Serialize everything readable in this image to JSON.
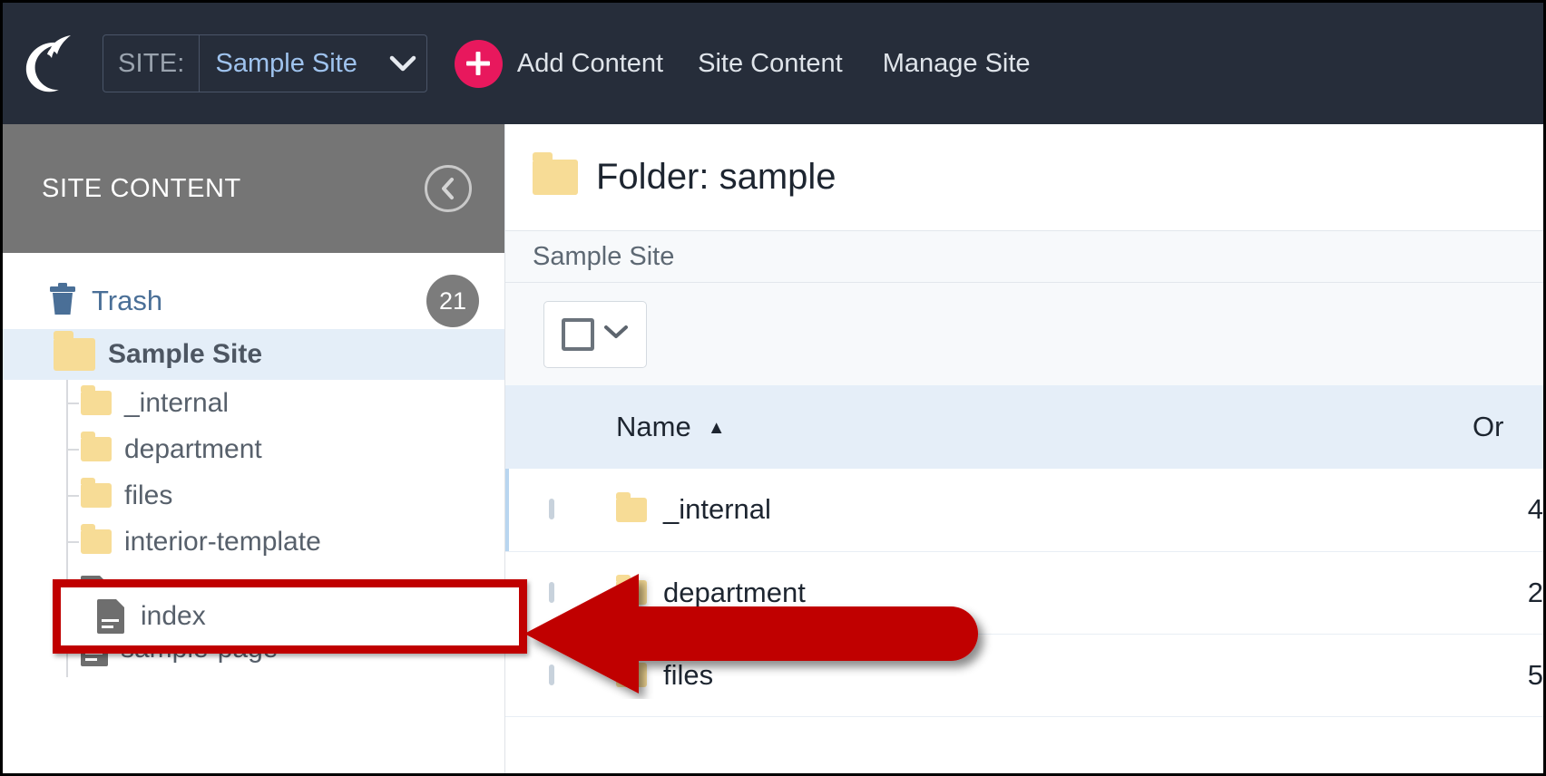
{
  "header": {
    "logo_name": "cascade-cms-logo",
    "site_selector": {
      "label": "SITE:",
      "value": "Sample Site"
    },
    "add_content_label": "Add Content",
    "nav_links": [
      {
        "label": "Site Content"
      },
      {
        "label": "Manage Site"
      }
    ],
    "accent_pink": "#e8185d",
    "background": "#262d3a"
  },
  "sidebar": {
    "title": "SITE CONTENT",
    "collapse_icon": "chevron-left-icon",
    "trash": {
      "label": "Trash",
      "count": "21"
    },
    "tree": [
      {
        "label": "Sample Site",
        "type": "folder",
        "level": 0,
        "selected": true
      },
      {
        "label": "_internal",
        "type": "folder",
        "level": 1,
        "selected": false
      },
      {
        "label": "department",
        "type": "folder",
        "level": 1,
        "selected": false
      },
      {
        "label": "files",
        "type": "folder",
        "level": 1,
        "selected": false
      },
      {
        "label": "interior-template",
        "type": "folder",
        "level": 1,
        "selected": false
      },
      {
        "label": "index",
        "type": "page",
        "level": 1,
        "selected": false,
        "highlighted": true
      },
      {
        "label": "sample-page",
        "type": "page",
        "level": 1,
        "selected": false
      }
    ]
  },
  "main": {
    "title": "Folder: sample",
    "title_icon": "folder-icon",
    "breadcrumb": "Sample Site",
    "toolbar": {
      "select_all_icon": "checkbox-icon",
      "select_all_caret": "chevron-down-icon"
    },
    "table": {
      "columns": [
        {
          "key": "name",
          "label": "Name",
          "sorted": "asc",
          "sort_icon": "caret-up-icon"
        },
        {
          "key": "order",
          "label": "Or"
        }
      ],
      "rows": [
        {
          "name": "_internal",
          "icon": "folder-icon",
          "order": "4",
          "checked": false
        },
        {
          "name": "department",
          "icon": "folder-icon",
          "order": "2",
          "checked": false
        },
        {
          "name": "files",
          "icon": "folder-icon",
          "order": "5",
          "checked": false
        }
      ]
    }
  },
  "annotations": {
    "arrow": {
      "name": "red-pointer-arrow",
      "color": "#c00000",
      "direction": "left"
    },
    "highlight_box": {
      "name": "red-highlight-box",
      "color": "#c00000",
      "target_label": "index"
    }
  }
}
